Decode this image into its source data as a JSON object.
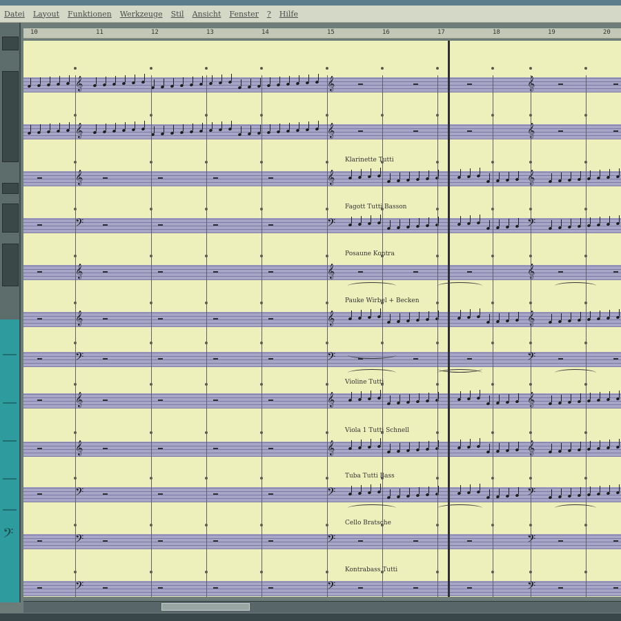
{
  "menu": [
    "Datei",
    "Layout",
    "Funktionen",
    "Werkzeuge",
    "Stil",
    "Ansicht",
    "Fenster",
    "?",
    "Hilfe"
  ],
  "ruler": [
    "10",
    "11",
    "12",
    "13",
    "14",
    "15",
    "16",
    "17",
    "18",
    "19",
    "20"
  ],
  "staff_labels": [
    "Klarinette Tutti",
    "Fagott Tutti Basson",
    "Posaune Kontra",
    "Pauke Wirbel + Becken",
    "Violine Tutti",
    "Viola 1 Tutti Schnell",
    "Tuba Tutti Bass",
    "Cello Bratsche",
    "Kontrabass Tutti"
  ]
}
